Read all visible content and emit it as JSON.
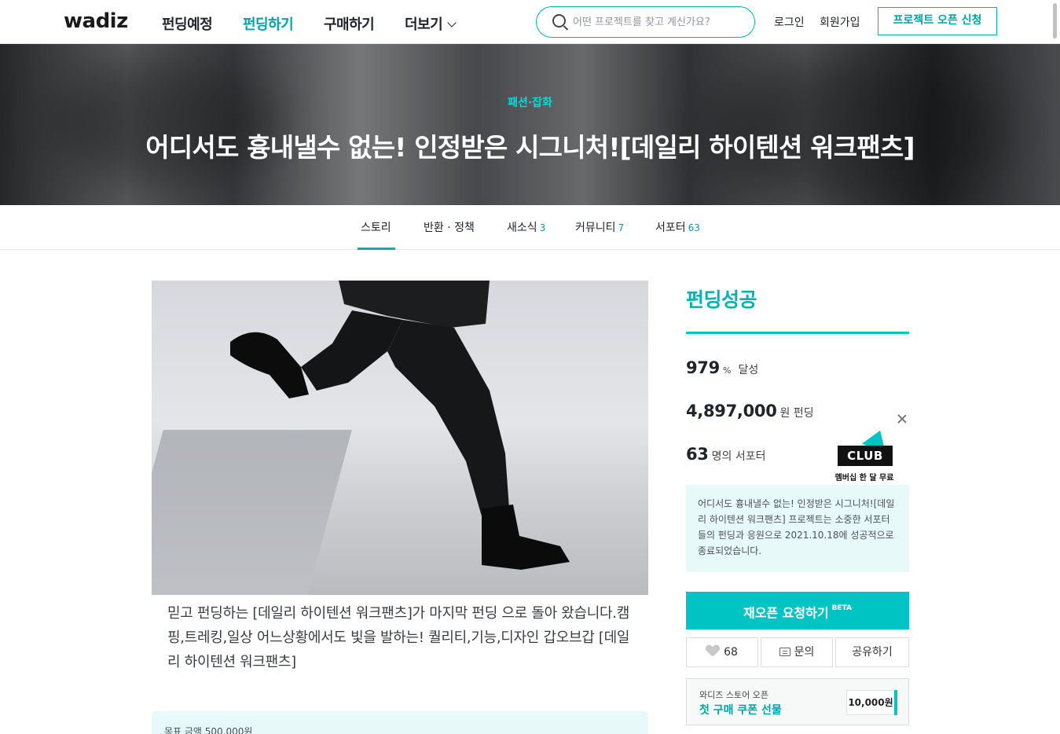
{
  "header": {
    "logo": "wadiz",
    "nav": [
      {
        "label": "펀딩예정",
        "active": false
      },
      {
        "label": "펀딩하기",
        "active": true
      },
      {
        "label": "구매하기",
        "active": false
      },
      {
        "label": "더보기",
        "active": false
      }
    ],
    "search_placeholder": "어떤 프로젝트를 찾고 계신가요?",
    "login": "로그인",
    "signup": "회원가입",
    "open_project": "프로젝트 오픈 신청"
  },
  "hero": {
    "category": "패션·잡화",
    "title": "어디서도 흉내낼수 없는! 인정받은 시그니처![데일리 하이텐션 워크팬츠]"
  },
  "tabs": [
    {
      "label": "스토리",
      "count": ""
    },
    {
      "label": "반환 · 정책",
      "count": ""
    },
    {
      "label": "새소식",
      "count": "3"
    },
    {
      "label": "커뮤니티",
      "count": "7"
    },
    {
      "label": "서포터",
      "count": "63"
    }
  ],
  "story": {
    "description": "믿고 펀딩하는 [데일리 하이텐션 워크팬츠]가 마지막 펀딩 으로 돌아 왔습니다.캠핑,트레킹,일상 어느상황에서도 빛을 발하는! 퀄리티,기능,디자인 갑오브갑 [데일리 하이텐션 워크팬츠]",
    "goal_text": "목표 금액 500,000원"
  },
  "sidebar": {
    "status": "펀딩성공",
    "rate_value": "979",
    "rate_unit": "%",
    "rate_suffix": "달성",
    "amount_value": "4,897,000",
    "amount_unit": "원 펀딩",
    "supporters_value": "63",
    "supporters_unit": "명의 서포터",
    "club_badge": "CLUB",
    "club_sub": "멤버십 한 달 무료",
    "notice": "어디서도 흉내낼수 없는! 인정받은 시그니처![데일리 하이텐션 워크팬츠] 프로젝트는 소중한 서포터들의 펀딩과 응원으로 2021.10.18에 성공적으로 종료되었습니다.",
    "reopen_label": "재오픈 요청하기",
    "reopen_beta": "BETA",
    "like_count": "68",
    "inquiry_label": "문의",
    "share_label": "공유하기",
    "coupon_line1": "와디즈 스토어 오픈",
    "coupon_line2": "첫 구매 쿠폰 선물",
    "coupon_amount": "10,000원"
  },
  "colors": {
    "accent": "#00c4c4",
    "accent_text": "#00a2a2",
    "notice_bg": "#e7f9f9"
  }
}
